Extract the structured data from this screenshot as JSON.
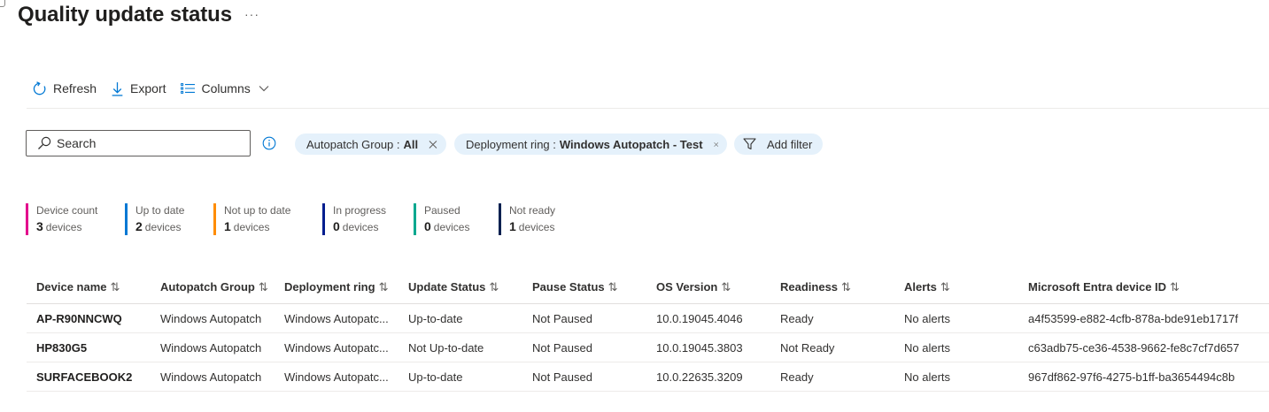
{
  "header": {
    "title": "Quality update status",
    "more_label": "···"
  },
  "toolbar": {
    "refresh_label": "Refresh",
    "export_label": "Export",
    "columns_label": "Columns"
  },
  "search": {
    "placeholder": "Search",
    "value": ""
  },
  "filters": [
    {
      "key": "Autopatch Group :",
      "value": "All"
    },
    {
      "key": "Deployment ring :",
      "value": "Windows Autopatch - Test"
    }
  ],
  "add_filter_label": "Add filter",
  "stats": [
    {
      "label": "Device count",
      "value": "3",
      "unit": "devices",
      "color": "#e3008c"
    },
    {
      "label": "Up to date",
      "value": "2",
      "unit": "devices",
      "color": "#0078d4"
    },
    {
      "label": "Not up to date",
      "value": "1",
      "unit": "devices",
      "color": "#ff8c00"
    },
    {
      "label": "In progress",
      "value": "0",
      "unit": "devices",
      "color": "#001d8f"
    },
    {
      "label": "Paused",
      "value": "0",
      "unit": "devices",
      "color": "#00a88f"
    },
    {
      "label": "Not ready",
      "value": "1",
      "unit": "devices",
      "color": "#002050"
    }
  ],
  "table": {
    "sort_glyph": "⇅",
    "columns": [
      "Device name",
      "Autopatch Group",
      "Deployment ring",
      "Update Status",
      "Pause Status",
      "OS Version",
      "Readiness",
      "Alerts",
      "Microsoft Entra device ID"
    ],
    "rows": [
      [
        "AP-R90NNCWQ",
        "Windows Autopatch",
        "Windows Autopatc...",
        "Up-to-date",
        "Not Paused",
        "10.0.19045.4046",
        "Ready",
        "No alerts",
        "a4f53599-e882-4cfb-878a-bde91eb1717f"
      ],
      [
        "HP830G5",
        "Windows Autopatch",
        "Windows Autopatc...",
        "Not Up-to-date",
        "Not Paused",
        "10.0.19045.3803",
        "Not Ready",
        "No alerts",
        "c63adb75-ce36-4538-9662-fe8c7cf7d657"
      ],
      [
        "SURFACEBOOK2",
        "Windows Autopatch",
        "Windows Autopatc...",
        "Up-to-date",
        "Not Paused",
        "10.0.22635.3209",
        "Ready",
        "No alerts",
        "967df862-97f6-4275-b1ff-ba3654494c8b"
      ]
    ]
  }
}
